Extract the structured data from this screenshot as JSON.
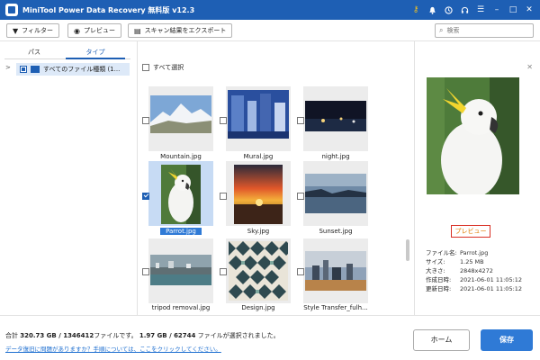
{
  "window": {
    "title": "MiniTool Power Data Recovery 無料版 v12.3",
    "icons": [
      "key-icon",
      "bell-icon",
      "clock-icon",
      "headset-icon",
      "menu-icon",
      "minimize-icon",
      "maximize-icon",
      "close-icon"
    ]
  },
  "toolbar": {
    "filter_label": "フィルター",
    "preview_label": "プレビュー",
    "export_label": "スキャン結果をエクスポート",
    "search_placeholder": "検索"
  },
  "sidebar": {
    "tabs": [
      {
        "label": "パス",
        "active": false
      },
      {
        "label": "タイプ",
        "active": true
      }
    ],
    "tree": [
      {
        "label": "すべてのファイル種類 (1...",
        "selected": true
      }
    ]
  },
  "content": {
    "select_all_label": "すべて選択",
    "files": [
      {
        "name": "Mountain.jpg",
        "checked": false,
        "selected": false
      },
      {
        "name": "Mural.jpg",
        "checked": false,
        "selected": false
      },
      {
        "name": "night.jpg",
        "checked": false,
        "selected": false
      },
      {
        "name": "Parrot.jpg",
        "checked": true,
        "selected": true
      },
      {
        "name": "Sky.jpg",
        "checked": false,
        "selected": false
      },
      {
        "name": "Sunset.jpg",
        "checked": false,
        "selected": false
      },
      {
        "name": "tripod removal.jpg",
        "checked": false,
        "selected": false
      },
      {
        "name": "Design.jpg",
        "checked": false,
        "selected": false
      },
      {
        "name": "Style Transfer_fulh...",
        "checked": false,
        "selected": false
      }
    ]
  },
  "preview": {
    "button_label": "プレビュー",
    "info": [
      {
        "key": "ファイル名:",
        "value": "Parrot.jpg"
      },
      {
        "key": "サイズ:",
        "value": "1.25 MB"
      },
      {
        "key": "大きさ:",
        "value": "2848x4272"
      },
      {
        "key": "作成日時:",
        "value": "2021-06-01 11:05:12"
      },
      {
        "key": "更新日時:",
        "value": "2021-06-01 11:05:12"
      }
    ]
  },
  "status": {
    "prefix": "合計 ",
    "total": "320.73 GB / 1346412",
    "mid": "ファイルです。",
    "selected": "1.97 GB / 62744",
    "suffix": " ファイルが選択されました。",
    "help_link": "データ復旧に問題がありますか？手順については、ここをクリックしてください。"
  },
  "buttons": {
    "home_label": "ホーム",
    "save_label": "保存"
  },
  "colors": {
    "titlebar": "#1e5fb4",
    "accent": "#2f7ad6",
    "preview_border": "#d93025"
  }
}
